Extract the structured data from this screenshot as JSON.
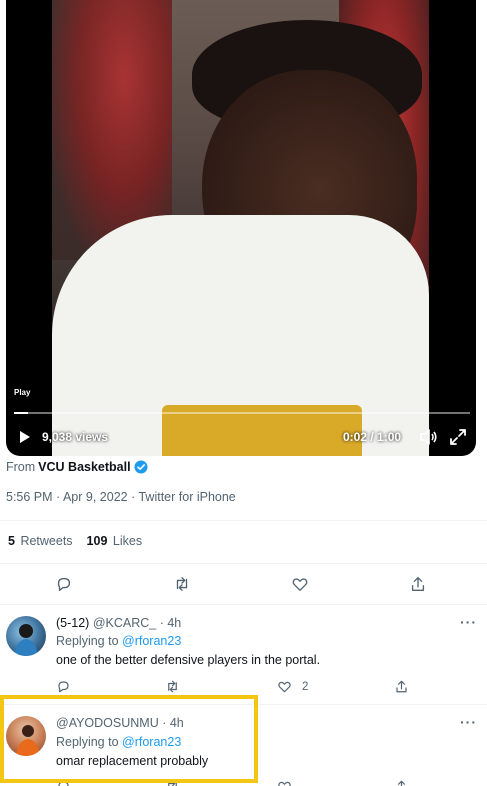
{
  "video": {
    "play_label": "Play",
    "views": "9,038 views",
    "time": "0:02 / 1:00",
    "progress": 0.03
  },
  "tweet": {
    "from_prefix": "From",
    "from_account": "VCU Basketball",
    "meta": "5:56 PM · Apr 9, 2022 · Twitter for iPhone",
    "retweets_count": "5",
    "retweets_label": "Retweets",
    "likes_count": "109",
    "likes_label": "Likes"
  },
  "replies": [
    {
      "name": "(5-12)",
      "handle_time": "@KCARC_ · 4h",
      "replying_prefix": "Replying to",
      "replying_to": "@rforan23",
      "text": "one of the better defensive players in the portal.",
      "like_count": "2"
    },
    {
      "name": "",
      "handle_time": "@AYODOSUNMU · 4h",
      "replying_prefix": "Replying to",
      "replying_to": "@rforan23",
      "text": "omar replacement probably",
      "like_count": ""
    }
  ],
  "colors": {
    "accent": "#1d9bf0",
    "highlight": "#f3c614",
    "secondary_text": "#536471"
  },
  "icons": [
    "play-icon",
    "volume-icon",
    "fullscreen-icon",
    "verified-icon",
    "reply-icon",
    "retweet-icon",
    "like-icon",
    "share-icon",
    "more-icon"
  ]
}
